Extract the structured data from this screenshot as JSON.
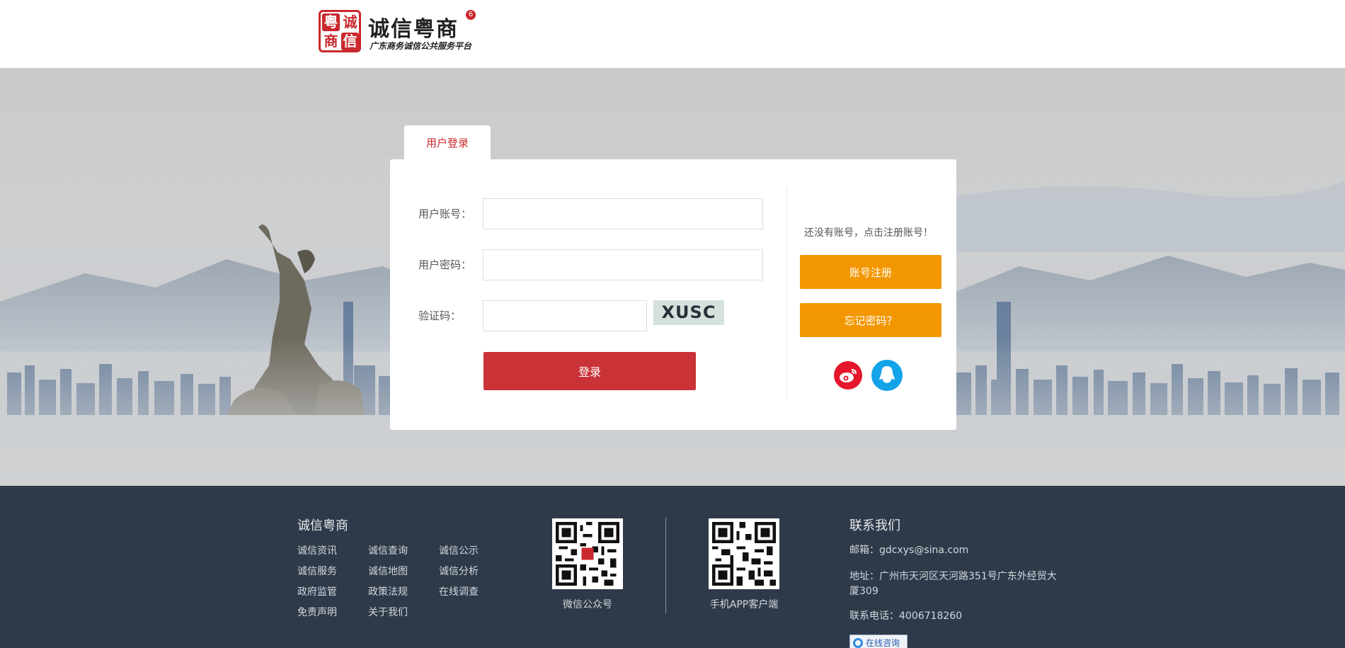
{
  "header": {
    "logo_title": "诚信粤商",
    "logo_badge": "6",
    "logo_subtitle": "广东商务诚信公共服务平台",
    "seal_chars": [
      "粤",
      "诚",
      "商",
      "信"
    ]
  },
  "login": {
    "tab_label": "用户登录",
    "account_label": "用户账号：",
    "password_label": "用户密码：",
    "captcha_label": "验证码：",
    "captcha_text": "XUSC",
    "login_button": "登录",
    "account_value": "",
    "password_value": "",
    "captcha_value": ""
  },
  "side": {
    "register_hint": "还没有账号，点击注册账号！",
    "register_button": "账号注册",
    "forgot_button": "忘记密码？",
    "weibo_icon": "weibo-icon",
    "qq_icon": "qq-icon"
  },
  "footer": {
    "brand_title": "诚信粤商",
    "links": [
      [
        "诚信资讯",
        "诚信查询",
        "诚信公示"
      ],
      [
        "诚信服务",
        "诚信地图",
        "诚信分析"
      ],
      [
        "政府监管",
        "政策法规",
        "在线调查"
      ],
      [
        "免责声明",
        "关于我们"
      ]
    ],
    "qr_wechat_label": "微信公众号",
    "qr_app_label": "手机APP客户端",
    "contact_title": "联系我们",
    "email": "邮箱：gdcxys@sina.com",
    "address": "地址：广州市天河区天河路351号广东外经贸大厦309",
    "phone": "联系电话：4006718260",
    "consult_button": "在线咨询"
  },
  "colors": {
    "brand_red": "#c9282d",
    "login_red": "#c93338",
    "orange": "#f39700",
    "footer_bg": "#2e3a49",
    "weibo": "#e6162d",
    "qq": "#12a3e9"
  }
}
